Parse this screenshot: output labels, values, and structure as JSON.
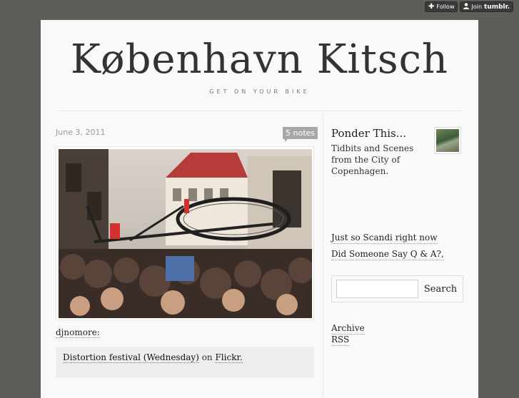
{
  "tumblr_controls": {
    "follow_label": "Follow",
    "join_label": "Join",
    "brand": "tumblr."
  },
  "header": {
    "title": "København Kitsch",
    "subtitle": "GET ON YOUR BIKE"
  },
  "post": {
    "date": "June 3, 2011",
    "notes": "5 notes",
    "source_user": "djnomore:",
    "quote_link": "Distortion festival (Wednesday)",
    "quote_mid": " on ",
    "quote_site": "Flickr."
  },
  "sidebar": {
    "title": "Ponder This...",
    "description": "Tidbits and Scenes from the City of Copenhagen.",
    "links": [
      {
        "label": "Just so Scandi right now"
      },
      {
        "label": "Did Someone Say Q & A?,"
      }
    ],
    "search": {
      "placeholder": "",
      "button_label": "Search"
    },
    "footer_links": [
      {
        "label": "Archive"
      },
      {
        "label": "RSS"
      }
    ]
  }
}
